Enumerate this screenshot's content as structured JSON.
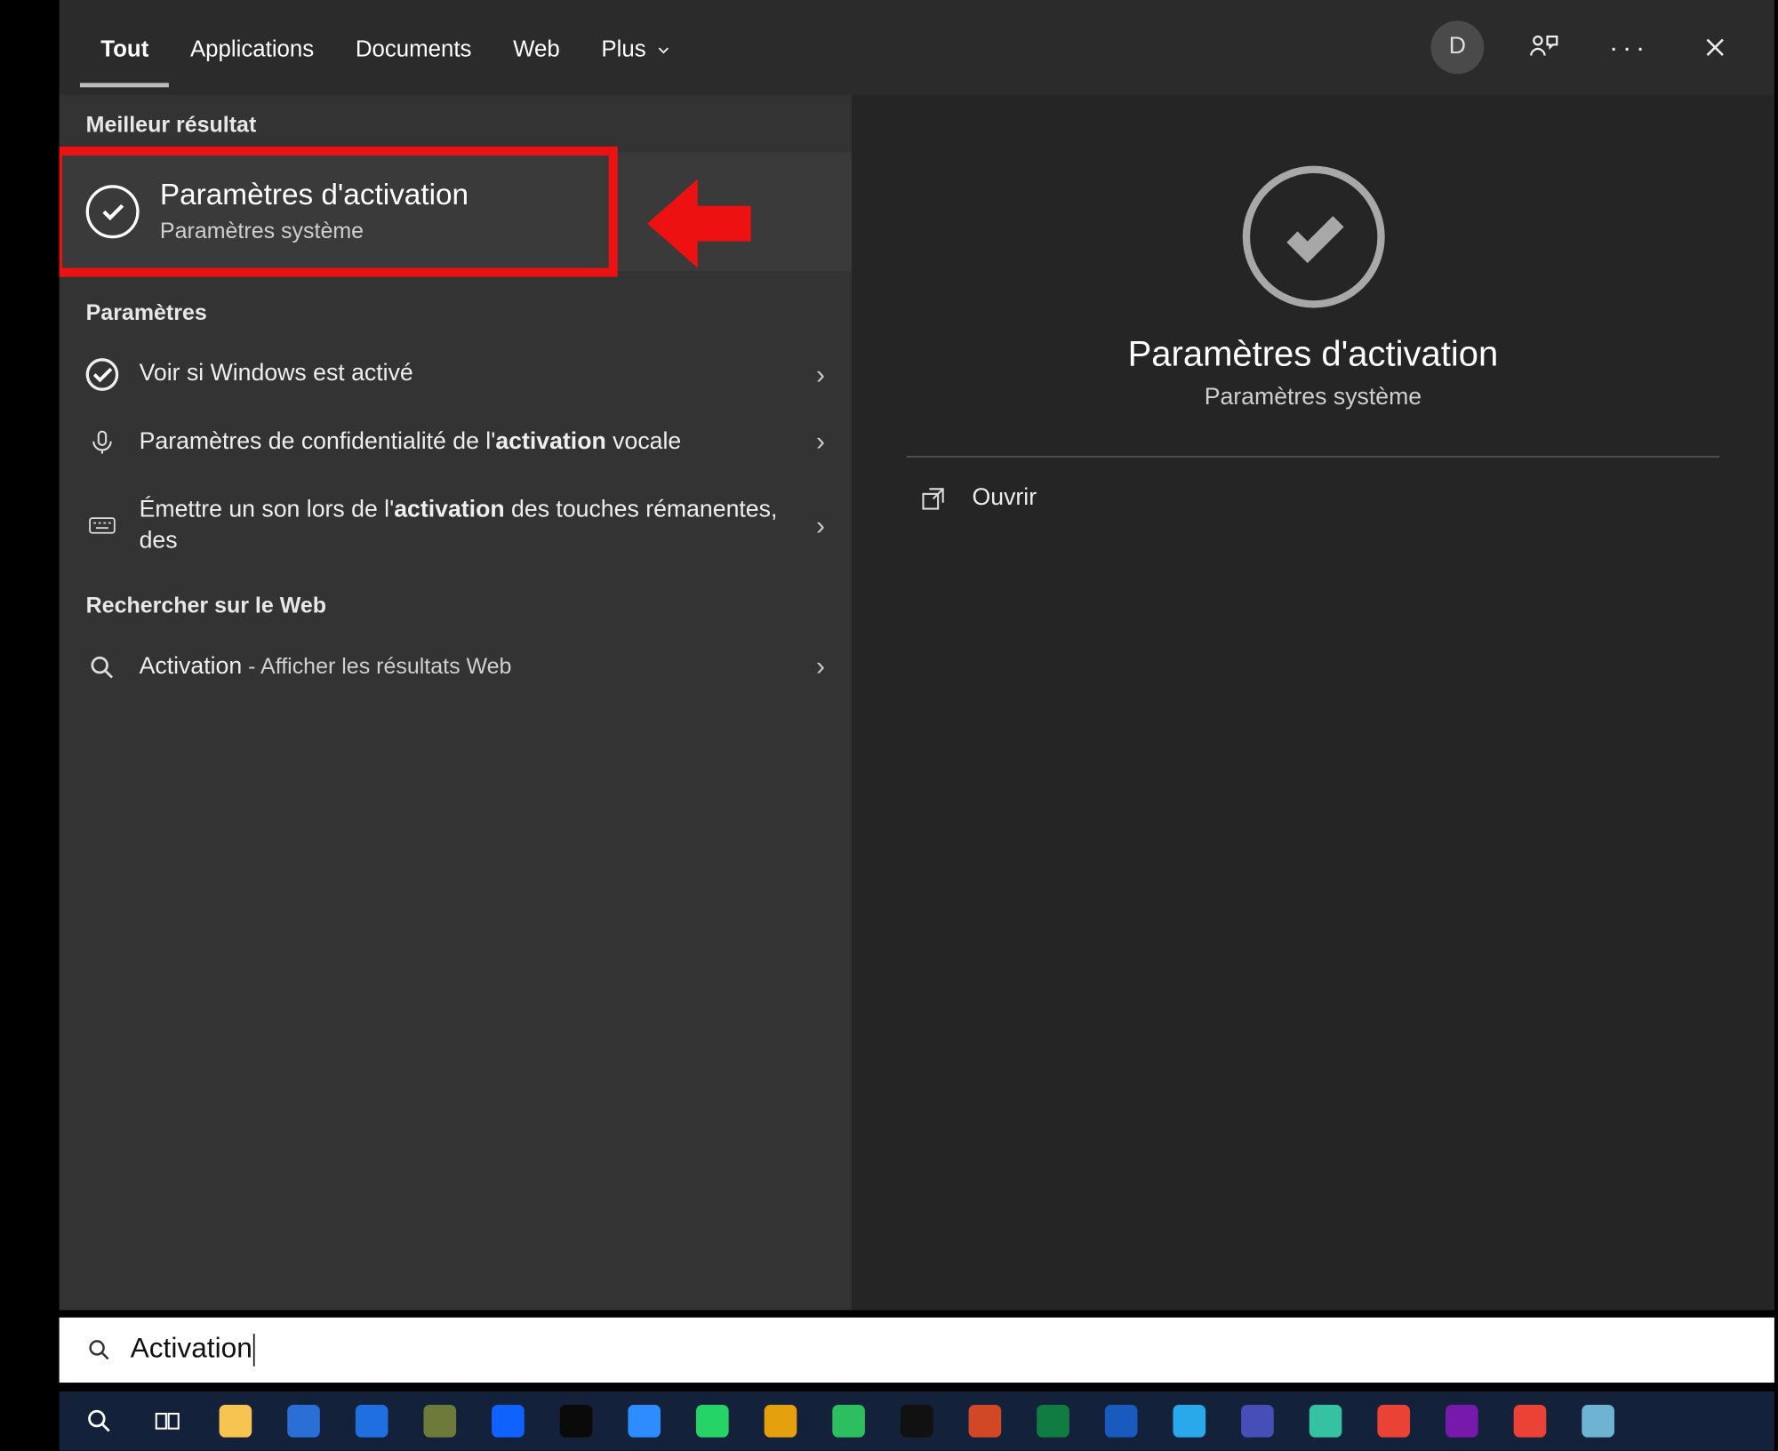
{
  "tabs": {
    "all": "Tout",
    "apps": "Applications",
    "docs": "Documents",
    "web": "Web",
    "more": "Plus"
  },
  "header": {
    "avatar_initial": "D"
  },
  "sections": {
    "best": "Meilleur résultat",
    "settings": "Paramètres",
    "web": "Rechercher sur le Web"
  },
  "best": {
    "title": "Paramètres d'activation",
    "subtitle": "Paramètres système"
  },
  "items": {
    "s1": "Voir si Windows est activé",
    "s2_pre": "Paramètres de confidentialité de l'",
    "s2_b": "activation",
    "s2_post": " vocale",
    "s3_pre": "Émettre un son lors de l'",
    "s3_b": "activation",
    "s3_post": " des touches rémanentes, des",
    "w1_a": "Activation",
    "w1_sep": " - ",
    "w1_b": "Afficher les résultats Web"
  },
  "preview": {
    "title": "Paramètres d'activation",
    "subtitle": "Paramètres système",
    "open": "Ouvrir"
  },
  "search": {
    "query": "Activation"
  },
  "taskbar_colors": {
    "explorer": "#f7c452",
    "monitor": "#2a6fd6",
    "mail": "#1f6fe0",
    "photos": "#6d7a3a",
    "dropbox": "#0f62fe",
    "tv": "#0a0a0a",
    "zoom": "#2d8cff",
    "whatsapp": "#25d366",
    "plex": "#e5a00d",
    "evernote": "#2dbe60",
    "xm": "#111",
    "ppt": "#d24726",
    "excel": "#107c41",
    "word": "#185abd",
    "telegram": "#29a9ea",
    "teams": "#464eb8",
    "edge": "#34c2a3",
    "chrome": "#ea4335",
    "onenote": "#7719aa",
    "g": "#ea4335",
    "notepad": "#6fb3d2"
  }
}
